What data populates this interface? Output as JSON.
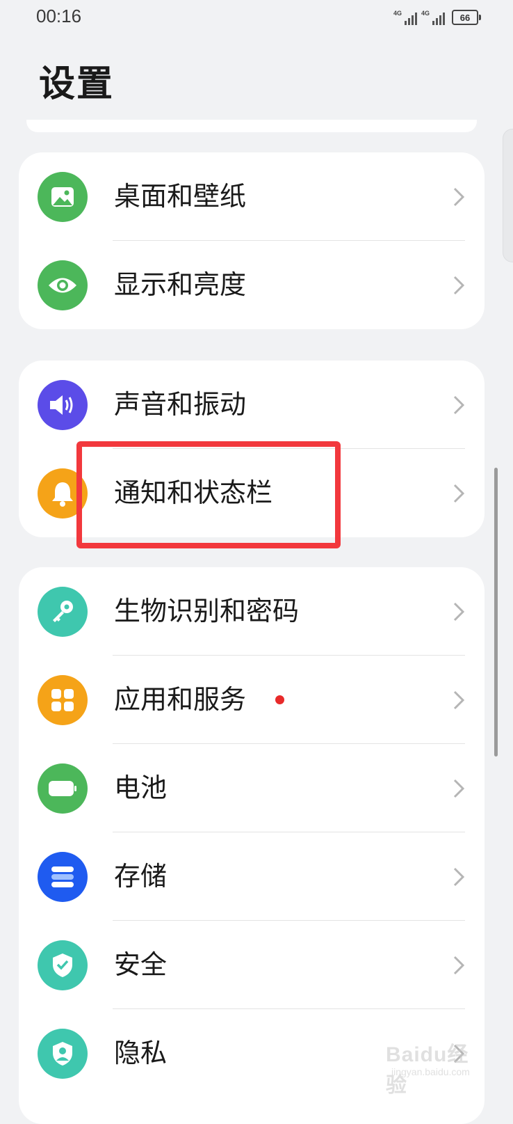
{
  "status_bar": {
    "time": "00:16",
    "network_1": "4G",
    "network_2": "4G",
    "battery": "66"
  },
  "page_title": "设置",
  "groups": [
    {
      "items": [
        {
          "label": "桌面和壁纸",
          "icon": "image-icon",
          "color": "#4cb75a"
        },
        {
          "label": "显示和亮度",
          "icon": "eye-icon",
          "color": "#4cb75a"
        }
      ]
    },
    {
      "items": [
        {
          "label": "声音和振动",
          "icon": "speaker-icon",
          "color": "#5b4ce8"
        },
        {
          "label": "通知和状态栏",
          "icon": "bell-icon",
          "color": "#f5a318"
        }
      ]
    },
    {
      "items": [
        {
          "label": "生物识别和密码",
          "icon": "key-icon",
          "color": "#3fc7ae"
        },
        {
          "label": "应用和服务",
          "icon": "apps-icon",
          "color": "#f5a318",
          "badge": "red-dot"
        },
        {
          "label": "电池",
          "icon": "battery-icon",
          "color": "#4cb75a"
        },
        {
          "label": "存储",
          "icon": "storage-icon",
          "color": "#1f5bf0"
        },
        {
          "label": "安全",
          "icon": "shield-check-icon",
          "color": "#3fc7ae"
        },
        {
          "label": "隐私",
          "icon": "privacy-shield-icon",
          "color": "#3fc7ae"
        }
      ]
    }
  ],
  "highlight_color": "#f2383d",
  "watermark": {
    "main": "Baidu经验",
    "sub": "jingyan.baidu.com"
  }
}
